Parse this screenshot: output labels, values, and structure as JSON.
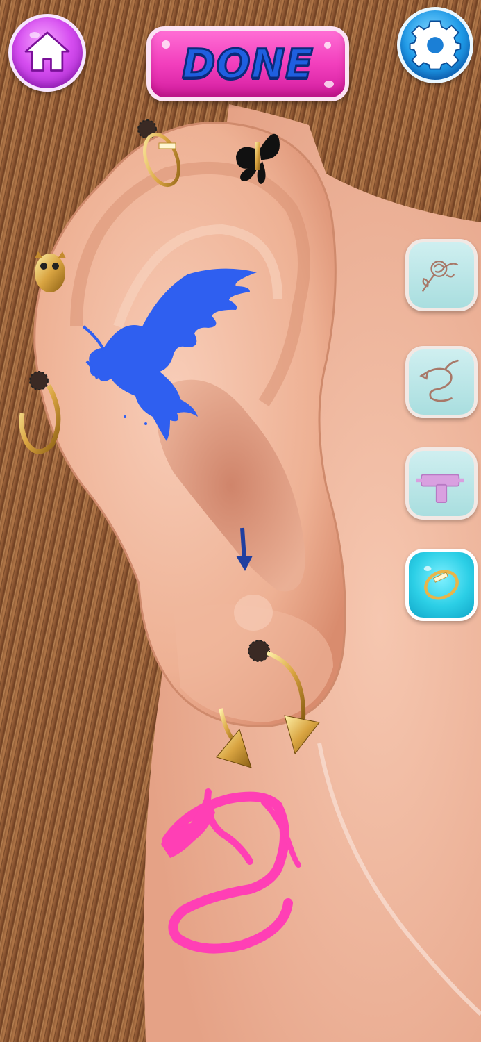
{
  "app": {
    "screen": "ear-piercing-studio"
  },
  "header": {
    "home_icon": "home-icon",
    "done_label": "DONE",
    "settings_icon": "gear-icon"
  },
  "tools": [
    {
      "id": "rose-tattoo",
      "icon": "rose-tattoo-icon",
      "active": false
    },
    {
      "id": "dragon-tattoo",
      "icon": "dragon-tattoo-icon",
      "active": false
    },
    {
      "id": "piercing-gun",
      "icon": "piercing-gun-icon",
      "active": false
    },
    {
      "id": "hoop-ring",
      "icon": "ring-icon",
      "active": true
    }
  ],
  "scene": {
    "tattoos": [
      "phoenix-tattoo",
      "dragon-tattoo"
    ],
    "jewelry": [
      "hoop-earring-top",
      "butterfly-stud",
      "owl-stud",
      "hoop-earring-side",
      "spike-hoop-lobe"
    ],
    "hint": "arrow-down-icon"
  },
  "colors": {
    "skin": "#f2b9a0",
    "hair": "#8a5331",
    "accent_pink": "#f23fbd",
    "accent_blue": "#1f5fe0",
    "tattoo_blue": "#2f5ff0",
    "tattoo_pink": "#ff3fb5",
    "gold": "#d9a441"
  }
}
